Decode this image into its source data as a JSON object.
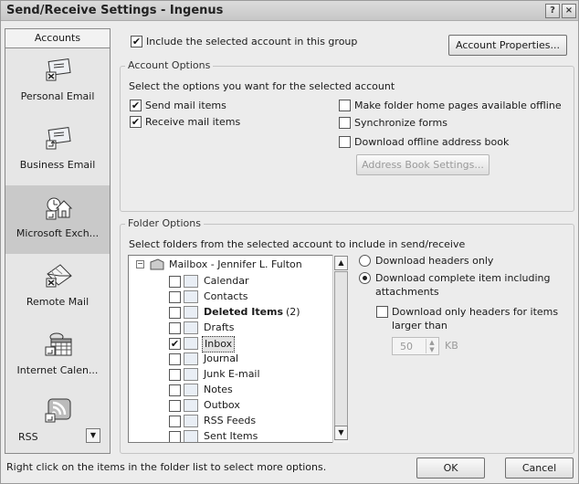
{
  "window": {
    "title": "Send/Receive Settings - Ingenus"
  },
  "titlebar": {
    "help_glyph": "?",
    "close_glyph": "×"
  },
  "sidebar": {
    "header": "Accounts",
    "items": [
      {
        "label": "Personal Email",
        "icon": "email-account-icon"
      },
      {
        "label": "Business Email",
        "icon": "email-account-icon"
      },
      {
        "label": "Microsoft Exch...",
        "icon": "exchange-house-icon"
      },
      {
        "label": "Remote Mail",
        "icon": "remote-mail-icon"
      },
      {
        "label": "Internet Calen...",
        "icon": "internet-calendar-icon"
      },
      {
        "label": "RSS",
        "icon": "rss-icon"
      }
    ]
  },
  "main": {
    "include_label": "Include the selected account in this group",
    "include_checked": true,
    "account_properties_label": "Account Properties...",
    "account_options": {
      "legend": "Account Options",
      "instruction": "Select the options you want for the selected account",
      "send_mail": "Send mail items",
      "receive_mail": "Receive mail items",
      "folder_home": "Make folder home pages available offline",
      "sync_forms": "Synchronize forms",
      "download_oab": "Download offline address book",
      "address_book_settings": "Address Book Settings..."
    },
    "folder_options": {
      "legend": "Folder Options",
      "instruction": "Select folders from the selected account to include in send/receive",
      "mailbox": "Mailbox - Jennifer L. Fulton",
      "folders": [
        {
          "label": "Calendar",
          "checked": false,
          "bold": false,
          "icon": "calendar-icon"
        },
        {
          "label": "Contacts",
          "checked": false,
          "bold": false,
          "icon": "contacts-icon"
        },
        {
          "label": "Deleted Items",
          "count": "(2)",
          "checked": false,
          "bold": true,
          "icon": "deleted-items-icon"
        },
        {
          "label": "Drafts",
          "checked": false,
          "bold": false,
          "icon": "drafts-icon"
        },
        {
          "label": "Inbox",
          "checked": true,
          "bold": false,
          "selected": true,
          "icon": "inbox-icon"
        },
        {
          "label": "Journal",
          "checked": false,
          "bold": false,
          "icon": "journal-icon"
        },
        {
          "label": "Junk E-mail",
          "checked": false,
          "bold": false,
          "icon": "junk-email-icon"
        },
        {
          "label": "Notes",
          "checked": false,
          "bold": false,
          "icon": "notes-icon"
        },
        {
          "label": "Outbox",
          "checked": false,
          "bold": false,
          "icon": "outbox-icon"
        },
        {
          "label": "RSS Feeds",
          "checked": false,
          "bold": false,
          "icon": "rss-feeds-icon"
        },
        {
          "label": "Sent Items",
          "checked": false,
          "bold": false,
          "icon": "sent-items-icon"
        }
      ],
      "download_headers_only": "Download headers only",
      "download_complete_line1": "Download complete item including",
      "download_complete_line2": "attachments",
      "download_only_headers_line1": "Download only headers for items",
      "download_only_headers_line2": "larger than",
      "size_value": "50",
      "size_unit": "KB"
    }
  },
  "footer": {
    "hint": "Right click on the items in the folder list to select more options.",
    "ok_label": "OK",
    "cancel_label": "Cancel"
  }
}
